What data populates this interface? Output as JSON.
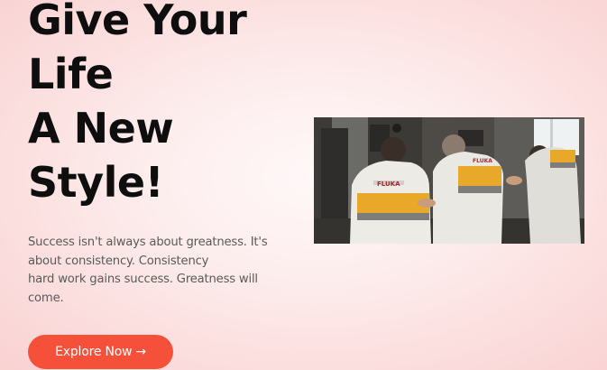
{
  "hero": {
    "title_lines": [
      "Give Your",
      "Life",
      "A New",
      "Style!"
    ],
    "description_lines": [
      "Success isn't always about greatness. It's",
      "about consistency. Consistency",
      "hard work gains success. Greatness will",
      "come."
    ],
    "cta_label": "Explore Now",
    "cta_arrow": "→",
    "photo_jacket_text": [
      "FLUKA",
      "FLUKA"
    ]
  },
  "colors": {
    "accent": "#f4503a",
    "jacket_stripe": "#e8a92a",
    "background": "#fbe2e2",
    "heading": "#0e0e0e",
    "body_text": "#5a5a5a"
  }
}
